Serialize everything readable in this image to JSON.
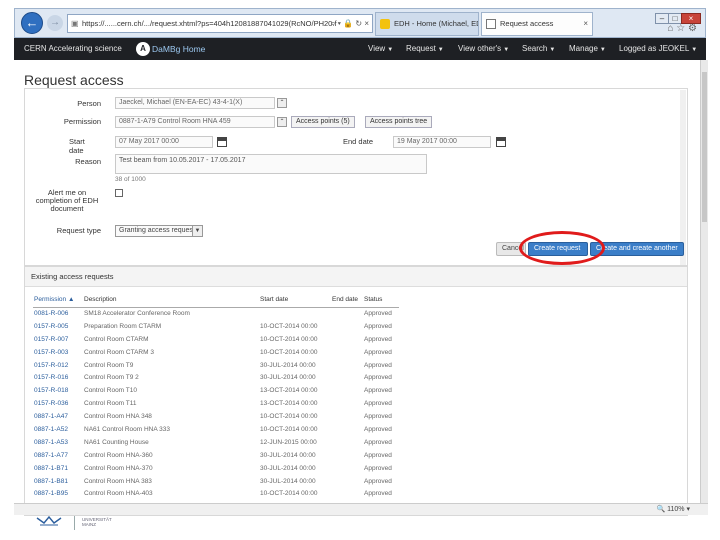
{
  "browser": {
    "address": "https://......cern.ch/.../request.xhtml?ps=404h12081887041029(RcNO/PH20.f",
    "address_icons": "⌕ ▾ 🔒 ↻ ×",
    "tabs": [
      {
        "label": "EDH - Home (Michael, EDKEL)",
        "active": false
      },
      {
        "label": "Request access",
        "active": true
      }
    ]
  },
  "navbar": {
    "brand": "CERN Accelerating science",
    "home_logo": "A",
    "home_label": "DaMBg Home",
    "items": [
      "View",
      "Request",
      "View other's",
      "Search",
      "Manage",
      "Logged as JEOKEL"
    ]
  },
  "page_title": "Request access",
  "form": {
    "person_label": "Person",
    "person_value": "Jaeckel, Michael (EN-EA-EC) 43-4-1(X)",
    "permission_label": "Permission",
    "permission_value": "0887-1-A79 Control Room HNA 459",
    "access_points_button": "Access points (5)",
    "access_points_tree_button": "Access points tree",
    "start_date_label": "Start date",
    "start_date_value": "07 May 2017 00:00",
    "end_date_label": "End date",
    "end_date_value": "19 May 2017 00:00",
    "reason_label": "Reason",
    "reason_value": "Test beam from 10.05.2017 - 17.05.2017",
    "char_count": "38 of 1000",
    "alert_label": "Alert me on completion of EDH document",
    "request_type_label": "Request type",
    "request_type_value": "Granting access request"
  },
  "buttons": {
    "cancel": "Cancel",
    "create_request": "Create request",
    "create_another": "Create and create another"
  },
  "requests": {
    "header": "Existing access requests",
    "columns": [
      "Permission ▲",
      "Description",
      "Start date",
      "End date",
      "Status"
    ],
    "rows": [
      [
        "0081-R-006",
        "SM18 Accelerator Conference Room",
        "",
        "",
        "Approved"
      ],
      [
        "0157-R-005",
        "Preparation Room CTARM",
        "10-OCT-2014 00:00",
        "",
        "Approved"
      ],
      [
        "0157-R-007",
        "Control Room CTARM",
        "10-OCT-2014 00:00",
        "",
        "Approved"
      ],
      [
        "0157-R-003",
        "Control Room CTARM 3",
        "10-OCT-2014 00:00",
        "",
        "Approved"
      ],
      [
        "0157-R-012",
        "Control Room T9",
        "30-JUL-2014 00:00",
        "",
        "Approved"
      ],
      [
        "0157-R-016",
        "Control Room T9 2",
        "30-JUL-2014 00:00",
        "",
        "Approved"
      ],
      [
        "0157-R-018",
        "Control Room T10",
        "13-OCT-2014 00:00",
        "",
        "Approved"
      ],
      [
        "0157-R-036",
        "Control Room T11",
        "13-OCT-2014 00:00",
        "",
        "Approved"
      ],
      [
        "0887-1-A47",
        "Control Room HNA 348",
        "10-OCT-2014 00:00",
        "",
        "Approved"
      ],
      [
        "0887-1-A52",
        "NA61 Control Room HNA 333",
        "10-OCT-2014 00:00",
        "",
        "Approved"
      ],
      [
        "0887-1-A53",
        "NA61 Counting House",
        "12-JUN-2015 00:00",
        "",
        "Approved"
      ],
      [
        "0887-1-A77",
        "Control Room HNA-360",
        "30-JUL-2014 00:00",
        "",
        "Approved"
      ],
      [
        "0887-1-B71",
        "Control Room HNA-370",
        "30-JUL-2014 00:00",
        "",
        "Approved"
      ],
      [
        "0887-1-B81",
        "Control Room HNA 383",
        "30-JUL-2014 00:00",
        "",
        "Approved"
      ],
      [
        "0887-1-B95",
        "Control Room HNA-403",
        "10-OCT-2014 00:00",
        "",
        "Approved"
      ]
    ]
  },
  "statusbar": {
    "zoom": "🔍 110% ▾"
  },
  "footer": {
    "text_line1": "UNIVERSITÄT",
    "text_line2": "MAINZ"
  },
  "colors": {
    "accent": "#3b7ec8",
    "navbar": "#1e2024",
    "highlight": "#e01b1b"
  }
}
